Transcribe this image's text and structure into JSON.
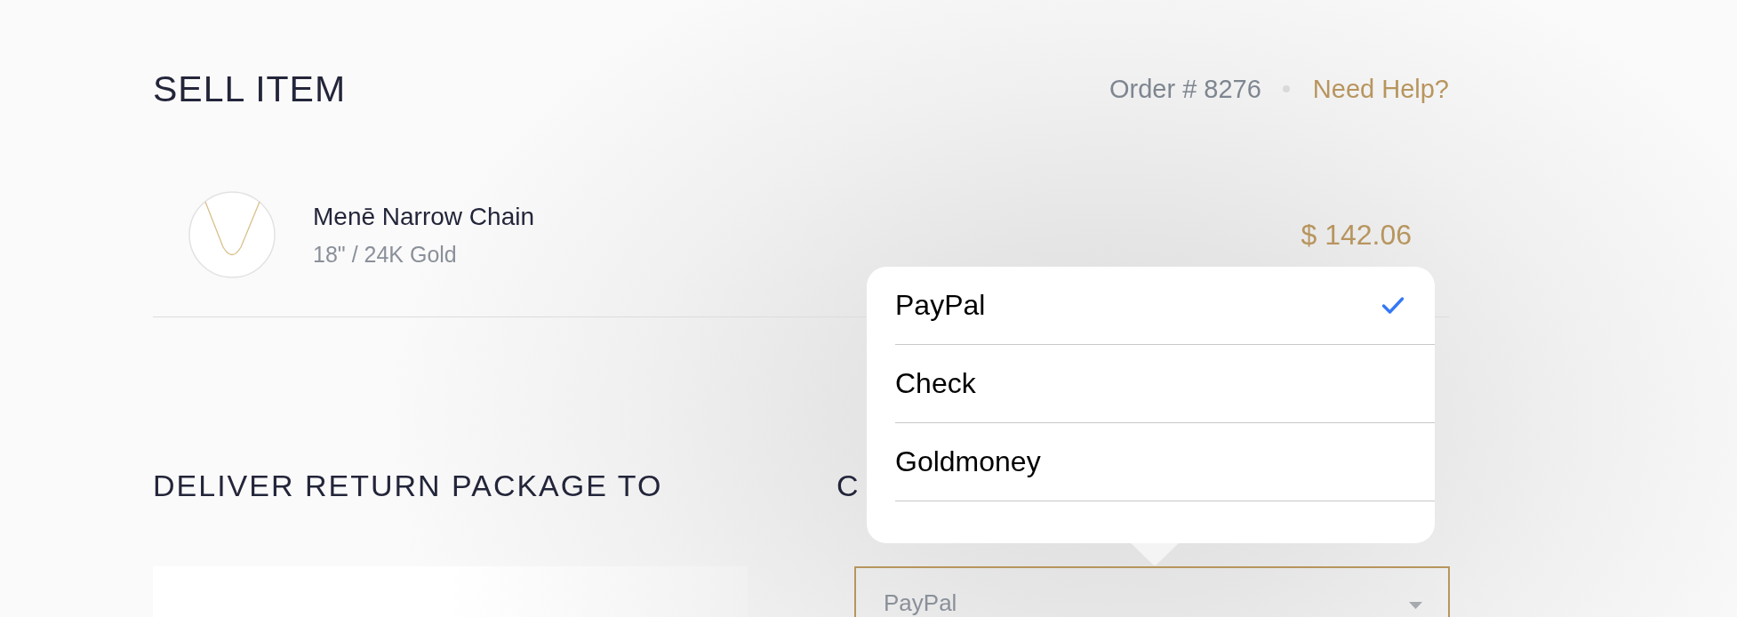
{
  "header": {
    "title": "SELL ITEM",
    "order": "Order # 8276",
    "help_link": "Need Help?"
  },
  "item": {
    "name": "Menē Narrow Chain",
    "details": "18\" / 24K Gold",
    "price": "$ 142.06"
  },
  "sections": [
    {
      "kind": "card",
      "heading": "DELIVER RETURN PACKAGE TO"
    },
    {
      "kind": "select",
      "heading": "C",
      "value": "PayPal"
    }
  ],
  "payment_menu": {
    "options": [
      {
        "label": "PayPal",
        "selected": true
      },
      {
        "label": "Check",
        "selected": false
      },
      {
        "label": "Goldmoney",
        "selected": false
      }
    ]
  }
}
